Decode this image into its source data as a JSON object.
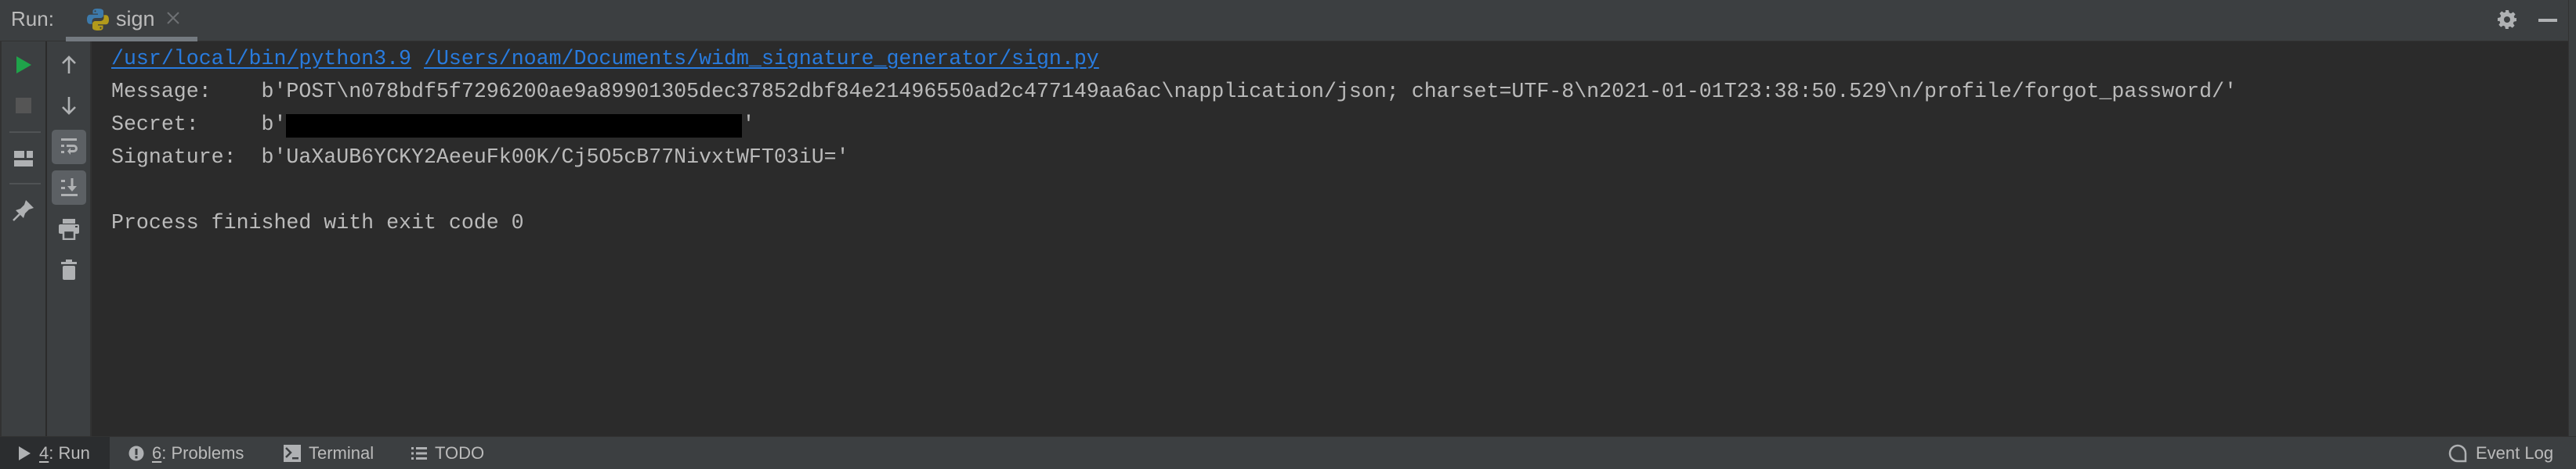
{
  "header": {
    "run_label": "Run:",
    "tab": {
      "label": "sign",
      "icon": "python-icon",
      "close_icon": "close-icon"
    },
    "actions": [
      {
        "name": "settings",
        "icon": "gear-icon"
      },
      {
        "name": "hide",
        "icon": "minimize-icon"
      }
    ]
  },
  "toolbar_left": [
    {
      "name": "rerun",
      "icon": "play-icon",
      "color": "#499c54"
    },
    {
      "name": "stop",
      "icon": "stop-icon",
      "enabled": false
    },
    {
      "name": "restore-layout",
      "icon": "layout-icon"
    },
    {
      "name": "pin-tab",
      "icon": "pin-icon"
    }
  ],
  "toolbar_console": [
    {
      "name": "up-stack-trace",
      "icon": "arrow-up-icon"
    },
    {
      "name": "down-stack-trace",
      "icon": "arrow-down-icon"
    },
    {
      "name": "soft-wrap",
      "icon": "soft-wrap-icon",
      "toggled": true
    },
    {
      "name": "scroll-to-end",
      "icon": "scroll-to-end-icon",
      "toggled": true
    },
    {
      "name": "print",
      "icon": "printer-icon"
    },
    {
      "name": "clear-all",
      "icon": "trash-icon"
    }
  ],
  "console": {
    "command": {
      "interpreter": "/usr/local/bin/python3.9",
      "script": "/Users/noam/Documents/widm_signature_generator/sign.py"
    },
    "lines": [
      {
        "label": "Message:    ",
        "value": "b'POST\\n078bdf5f7296200ae9a89901305dec37852dbf84e21496550ad2c477149aa6ac\\napplication/json; charset=UTF-8\\n2021-01-01T23:38:50.529\\n/profile/forgot_password/'"
      },
      {
        "label": "Secret:     ",
        "prefix": "b'",
        "suffix": "'",
        "redacted": true
      },
      {
        "label": "Signature:  ",
        "value": "b'UaXaUB6YCKY2AeeuFk00K/Cj5O5cB77NivxtWFT03iU='"
      }
    ],
    "exit_message": "Process finished with exit code 0"
  },
  "bottom_bar": {
    "left": [
      {
        "mnemonic": "4",
        "label": ": Run",
        "icon": "play-icon",
        "active": true
      },
      {
        "mnemonic": "6",
        "label": ": Problems",
        "icon": "warning-circle-icon"
      },
      {
        "mnemonic": "",
        "label": "Terminal",
        "icon": "terminal-icon"
      },
      {
        "mnemonic": "",
        "label": "TODO",
        "icon": "list-icon"
      }
    ],
    "right": [
      {
        "label": "Event Log",
        "icon": "speech-bubble-icon"
      }
    ]
  },
  "colors": {
    "panel_bg": "#3c3f41",
    "console_bg": "#2b2b2b",
    "text": "#bbbbbb",
    "link": "#287bde",
    "run_green": "#499c54",
    "icon_gray": "#afb1b3"
  }
}
